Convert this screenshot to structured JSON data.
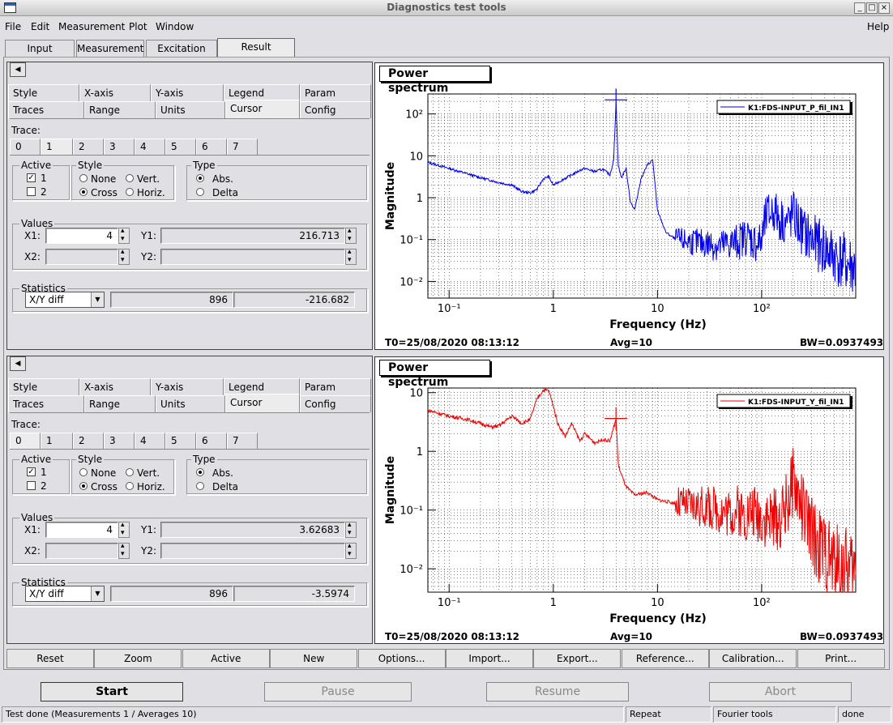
{
  "window": {
    "title": "Diagnostics test tools"
  },
  "menu": {
    "items": [
      "File",
      "Edit",
      "Measurement",
      "Plot",
      "Window"
    ],
    "help": "Help"
  },
  "main_tabs": [
    "Input",
    "Measurement",
    "Excitation",
    "Result"
  ],
  "active_main_tab": "Result",
  "panels": [
    {
      "subtabs_row1": [
        "Style",
        "X-axis",
        "Y-axis",
        "Legend",
        "Param"
      ],
      "subtabs_row2": [
        "Traces",
        "Range",
        "Units",
        "Cursor",
        "Config"
      ],
      "trace_label": "Trace:",
      "trace_tabs": [
        "0",
        "1",
        "2",
        "3",
        "4",
        "5",
        "6",
        "7"
      ],
      "active_trace": "1",
      "active_label": "Active",
      "active_items": [
        "1",
        "2"
      ],
      "style_label": "Style",
      "style_opts": [
        "None",
        "Vert.",
        "Cross",
        "Horiz."
      ],
      "type_label": "Type",
      "type_opts": [
        "Abs.",
        "Delta"
      ],
      "values_label": "Values",
      "x1_label": "X1:",
      "x1": "4",
      "y1_label": "Y1:",
      "y1": "216.713",
      "x2_label": "X2:",
      "y2_label": "Y2:",
      "stats_label": "Statistics",
      "stats_select": "X/Y diff",
      "stat_a": "896",
      "stat_b": "-216.682"
    },
    {
      "subtabs_row1": [
        "Style",
        "X-axis",
        "Y-axis",
        "Legend",
        "Param"
      ],
      "subtabs_row2": [
        "Traces",
        "Range",
        "Units",
        "Cursor",
        "Config"
      ],
      "trace_label": "Trace:",
      "trace_tabs": [
        "0",
        "1",
        "2",
        "3",
        "4",
        "5",
        "6",
        "7"
      ],
      "active_trace": "0",
      "active_label": "Active",
      "active_items": [
        "1",
        "2"
      ],
      "style_label": "Style",
      "style_opts": [
        "None",
        "Vert.",
        "Cross",
        "Horiz."
      ],
      "type_label": "Type",
      "type_opts": [
        "Abs.",
        "Delta"
      ],
      "values_label": "Values",
      "x1_label": "X1:",
      "x1": "4",
      "y1_label": "Y1:",
      "y1": "3.62683",
      "x2_label": "X2:",
      "y2_label": "Y2:",
      "stats_label": "Statistics",
      "stats_select": "X/Y diff",
      "stat_a": "896",
      "stat_b": "-3.5974"
    }
  ],
  "plots": [
    {
      "title": "Power spectrum",
      "t0": "T0=25/08/2020 08:13:12",
      "avg": "Avg=10",
      "bw": "BW=0.0937493"
    },
    {
      "title": "Power spectrum",
      "t0": "T0=25/08/2020 08:13:12",
      "avg": "Avg=10",
      "bw": "BW=0.0937493"
    }
  ],
  "chart_data": [
    {
      "type": "line",
      "xlabel": "Frequency (Hz)",
      "ylabel": "Magnitude",
      "xscale": "log",
      "yscale": "log",
      "xlim": [
        0.0625,
        800
      ],
      "ylim": [
        0.004,
        300
      ],
      "x_ticks": [
        "10⁻¹",
        "1",
        "10",
        "10²"
      ],
      "y_ticks": [
        "10⁻²",
        "10⁻¹",
        "1",
        "10",
        "10²"
      ],
      "grid": true,
      "legend_position": "top-right",
      "cursor": {
        "x": 4,
        "y": 216.713
      },
      "series": [
        {
          "name": "K1:FDS-INPUT_P_fil_IN1",
          "color": "#0000ee",
          "x": [
            0.0625,
            0.1,
            0.2,
            0.3,
            0.4,
            0.5,
            0.6,
            0.7,
            0.8,
            0.9,
            1.0,
            1.2,
            1.5,
            1.8,
            2.0,
            2.5,
            3.0,
            3.5,
            3.8,
            4.0,
            4.2,
            4.5,
            5.0,
            5.5,
            6.0,
            7.0,
            8.0,
            9.0,
            10,
            12,
            15,
            20,
            30,
            40,
            50,
            60,
            70,
            80,
            90,
            100,
            110,
            130,
            150,
            180,
            200,
            250,
            300,
            400,
            500,
            600,
            800
          ],
          "y": [
            7,
            5,
            3,
            2.3,
            2.0,
            1.4,
            1.3,
            1.6,
            2.8,
            3.2,
            2.0,
            2.6,
            3.5,
            4.5,
            5.0,
            4.2,
            4.8,
            3.5,
            8,
            200,
            6,
            3,
            5,
            0.8,
            0.5,
            3,
            6,
            8,
            0.5,
            0.15,
            0.1,
            0.09,
            0.08,
            0.07,
            0.08,
            0.09,
            0.12,
            0.1,
            0.08,
            0.09,
            0.35,
            0.5,
            0.3,
            0.25,
            0.4,
            0.15,
            0.1,
            0.06,
            0.04,
            0.03,
            0.02
          ]
        }
      ]
    },
    {
      "type": "line",
      "xlabel": "Frequency (Hz)",
      "ylabel": "Magnitude",
      "xscale": "log",
      "yscale": "log",
      "xlim": [
        0.0625,
        800
      ],
      "ylim": [
        0.004,
        12
      ],
      "x_ticks": [
        "10⁻¹",
        "1",
        "10",
        "10²"
      ],
      "y_ticks": [
        "10⁻²",
        "10⁻¹",
        "1",
        "10"
      ],
      "grid": true,
      "legend_position": "top-right",
      "cursor": {
        "x": 4,
        "y": 3.62683
      },
      "series": [
        {
          "name": "K1:FDS-INPUT_Y_fil_IN1",
          "color": "#ee0000",
          "x": [
            0.0625,
            0.1,
            0.15,
            0.2,
            0.25,
            0.3,
            0.4,
            0.5,
            0.6,
            0.7,
            0.8,
            0.9,
            1.0,
            1.1,
            1.3,
            1.5,
            1.8,
            2.0,
            2.5,
            3.0,
            3.5,
            4.0,
            4.2,
            4.5,
            5.0,
            6.0,
            8.0,
            10,
            15,
            20,
            30,
            40,
            50,
            60,
            70,
            80,
            100,
            120,
            150,
            180,
            200,
            220,
            250,
            300,
            400,
            500,
            600,
            800
          ],
          "y": [
            5,
            4,
            3.5,
            3.0,
            2.6,
            2.7,
            4,
            3,
            3.5,
            8,
            11,
            11,
            6,
            3,
            1.8,
            3,
            1.5,
            2,
            1.4,
            1.6,
            1.5,
            3.6,
            0.6,
            0.4,
            0.25,
            0.18,
            0.2,
            0.15,
            0.13,
            0.12,
            0.11,
            0.1,
            0.09,
            0.1,
            0.08,
            0.1,
            0.08,
            0.07,
            0.07,
            0.15,
            0.3,
            0.2,
            0.1,
            0.04,
            0.02,
            0.012,
            0.01,
            0.008
          ]
        }
      ]
    }
  ],
  "toolbar": [
    "Reset",
    "Zoom",
    "Active",
    "New",
    "Options...",
    "Import...",
    "Export...",
    "Reference...",
    "Calibration...",
    "Print..."
  ],
  "controls": {
    "start": "Start",
    "pause": "Pause",
    "resume": "Resume",
    "abort": "Abort"
  },
  "status": {
    "main": "Test done (Measurements 1 / Averages 10)",
    "mode": "Repeat",
    "tool": "Fourier tools",
    "state": "done"
  }
}
